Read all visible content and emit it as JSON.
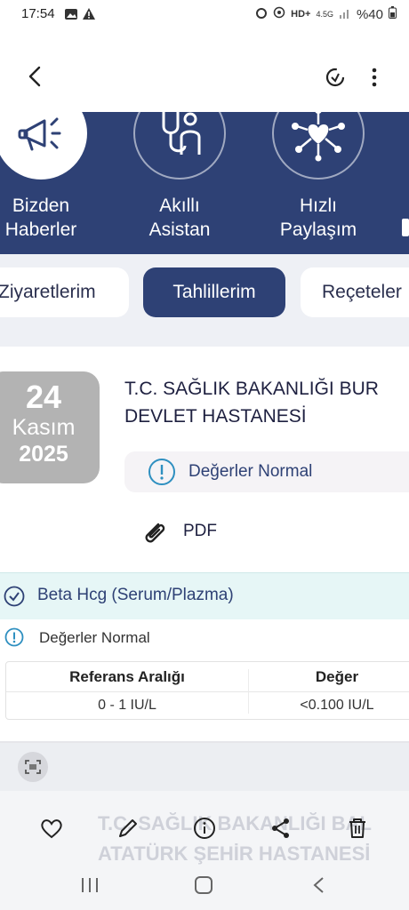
{
  "status_bar": {
    "time": "17:54",
    "battery": "%40",
    "network": "4.5G"
  },
  "quick_actions": [
    {
      "label_line1": "Bizden",
      "label_line2": "Haberler",
      "icon": "megaphone-icon"
    },
    {
      "label_line1": "Akıllı",
      "label_line2": "Asistan",
      "icon": "stethoscope-icon"
    },
    {
      "label_line1": "Hızlı",
      "label_line2": "Paylaşım",
      "icon": "share-network-icon"
    }
  ],
  "tabs": [
    {
      "label": "Ziyaretlerim",
      "active": false
    },
    {
      "label": "Tahlillerim",
      "active": true
    },
    {
      "label": "Reçeteler",
      "active": false
    }
  ],
  "lab_result": {
    "date_day": "24",
    "date_month": "Kasım",
    "date_year": "2025",
    "hospital_line1": "T.C. SAĞLIK BAKANLIĞI BUR",
    "hospital_line2": "DEVLET HASTANESİ",
    "status": "Değerler Normal",
    "pdf_label": "PDF"
  },
  "test": {
    "name": "Beta Hcg (Serum/Plazma)",
    "status": "Değerler Normal",
    "table": {
      "headers": [
        "Referans Aralığı",
        "Değer"
      ],
      "row": [
        "0 - 1 IU/L",
        "<0.100 IU/L"
      ]
    }
  },
  "next_card": {
    "line1": "T.C. SAĞLIK BAKANLIĞI BAL",
    "line2": "ATATÜRK ŞEHİR HASTANESİ"
  },
  "colors": {
    "brand": "#2e4175",
    "teal_bg": "#e6f6f6",
    "date_box": "#b3b3b3"
  }
}
